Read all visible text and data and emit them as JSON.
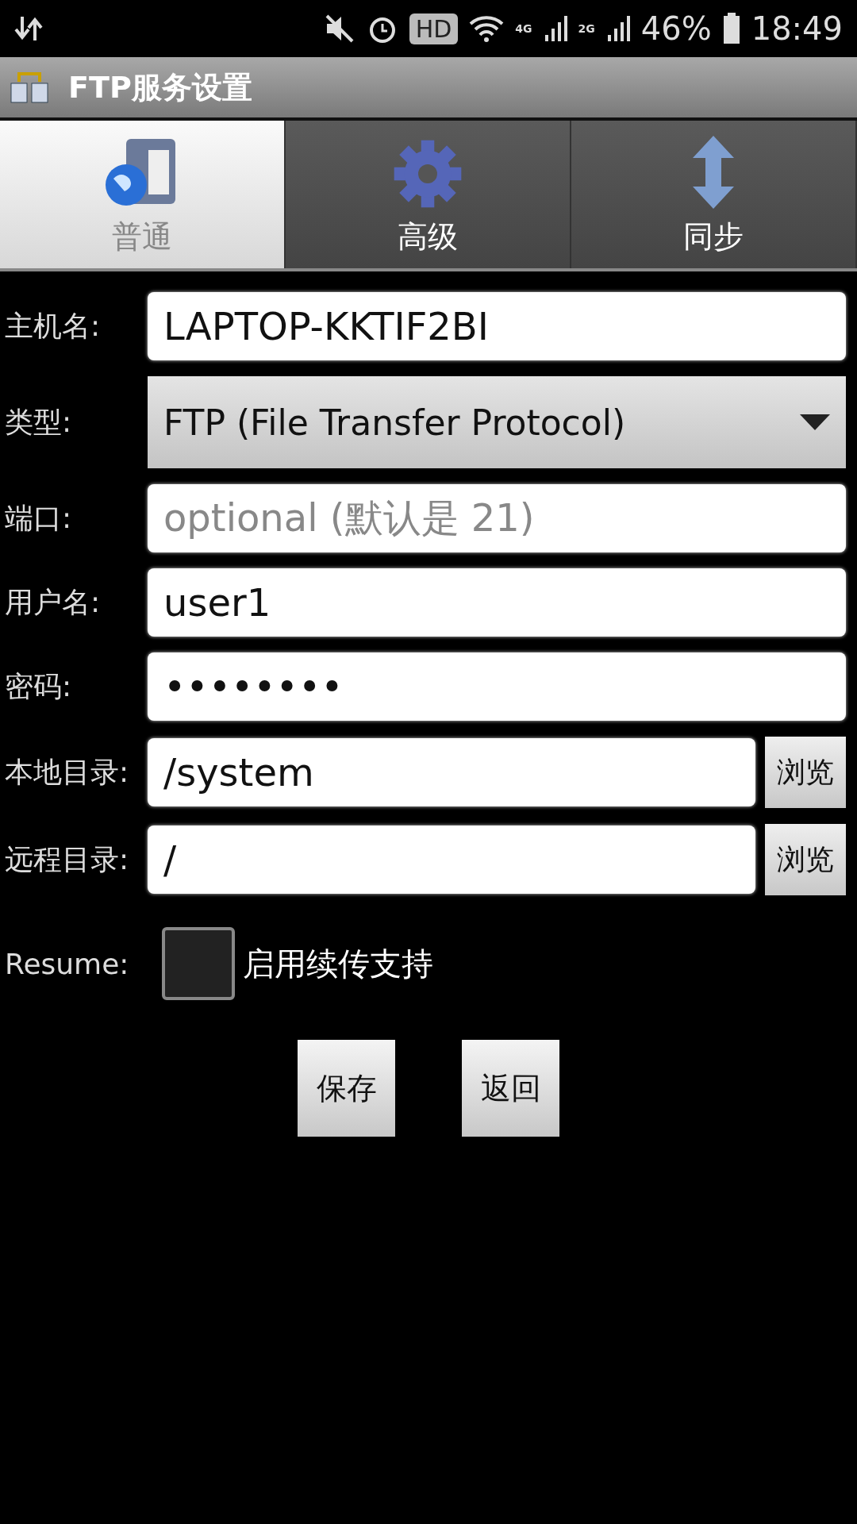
{
  "status_bar": {
    "battery": "46%",
    "time": "18:49",
    "network_4g": "4G",
    "network_2g": "2G",
    "hd_badge": "HD"
  },
  "title_bar": {
    "title": "FTP服务设置"
  },
  "tabs": [
    {
      "label": "普通",
      "selected": true,
      "kind": "server"
    },
    {
      "label": "高级",
      "selected": false,
      "kind": "gear"
    },
    {
      "label": "同步",
      "selected": false,
      "kind": "arrows"
    }
  ],
  "form": [
    {
      "kind": "text",
      "label": "主机名:",
      "value": "LAPTOP-KKTIF2BI"
    },
    {
      "kind": "select",
      "label": "类型:",
      "value": "FTP (File Transfer Protocol)"
    },
    {
      "kind": "text",
      "label": "端口:",
      "placeholder": "optional (默认是 21)"
    },
    {
      "kind": "text",
      "label": "用户名:",
      "value": "user1"
    },
    {
      "kind": "text",
      "label": "密码:",
      "value": "••••••••"
    },
    {
      "kind": "browse",
      "label": "本地目录:",
      "value": "/system",
      "button": "浏览"
    },
    {
      "kind": "browse",
      "label": "远程目录:",
      "value": "/",
      "button": "浏览"
    }
  ],
  "resume": {
    "label": "Resume:",
    "checked": false,
    "text": "启用续传支持"
  },
  "buttons": [
    "保存",
    "返回"
  ]
}
